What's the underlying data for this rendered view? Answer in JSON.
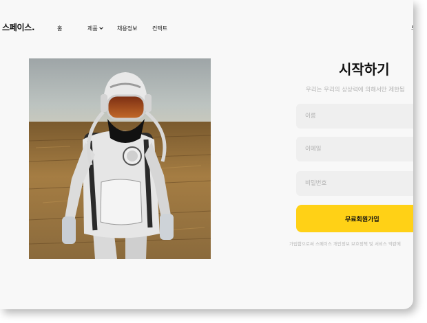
{
  "nav": {
    "logo": "스페이스.",
    "links": [
      {
        "label": "홈"
      },
      {
        "label": "제품"
      },
      {
        "label": "채용정보"
      },
      {
        "label": "컨택트"
      }
    ],
    "right_edge_label": "로"
  },
  "hero": {
    "image_icon": "astronaut-photo"
  },
  "signup": {
    "title": "시작하기",
    "subtitle": "우리는 우리의 상상력에 의해서만 제한됩",
    "name_placeholder": "이름",
    "email_placeholder": "이메일",
    "password_placeholder": "비밀번호",
    "submit_label": "무료회원가입",
    "terms": "가입함으로써 스페이스 개인정보 보호정책 및 서비스 약관에"
  },
  "colors": {
    "accent": "#ffd116",
    "background": "#f8f8f8",
    "field": "#efefef"
  }
}
